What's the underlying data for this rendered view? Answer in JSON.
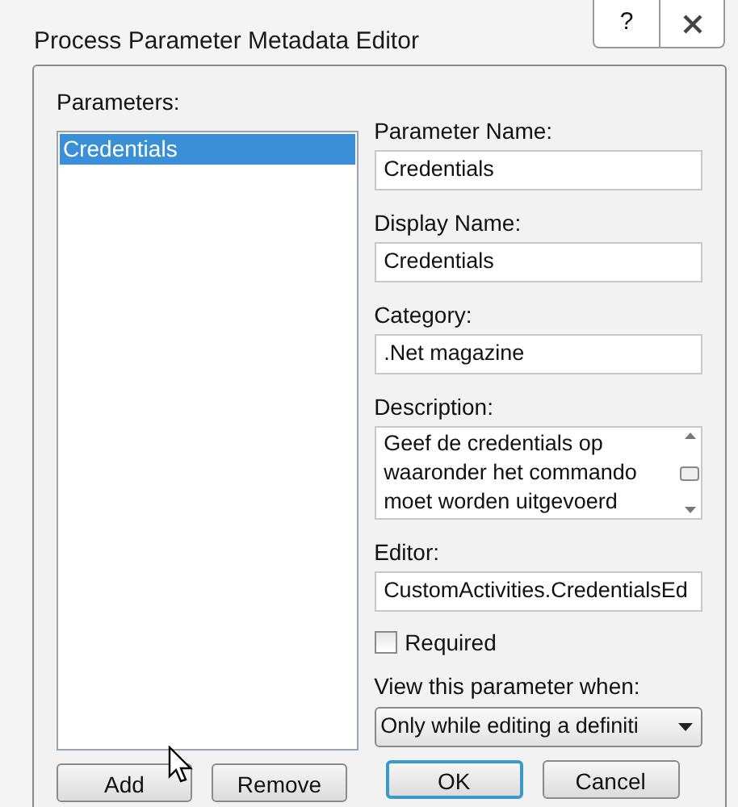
{
  "window": {
    "title": "Process Parameter Metadata Editor",
    "buttons": [
      {
        "kind": "help",
        "label": "?"
      },
      {
        "kind": "close"
      }
    ]
  },
  "parameters": {
    "label": "Parameters:",
    "items": [
      {
        "label": "Credentials",
        "selected": true
      }
    ]
  },
  "fields": [
    {
      "kind": "text",
      "label": "Parameter Name:",
      "value": "Credentials"
    },
    {
      "kind": "text",
      "label": "Display Name:",
      "value": "Credentials"
    },
    {
      "kind": "text",
      "label": "Category:",
      "value": ".Net magazine"
    },
    {
      "kind": "textarea",
      "label": "Description:",
      "value": "Geef de credentials op waaronder het commando moet worden uitgevoerd"
    },
    {
      "kind": "text",
      "label": "Editor:",
      "value": "CustomActivities.CredentialsEd"
    }
  ],
  "required": {
    "label": "Required",
    "checked": false
  },
  "view_when": {
    "label": "View this parameter when:",
    "value": "Only while editing a definiti"
  },
  "list_buttons": [
    "Add",
    "Remove"
  ],
  "dialog_buttons": [
    "OK",
    "Cancel"
  ]
}
